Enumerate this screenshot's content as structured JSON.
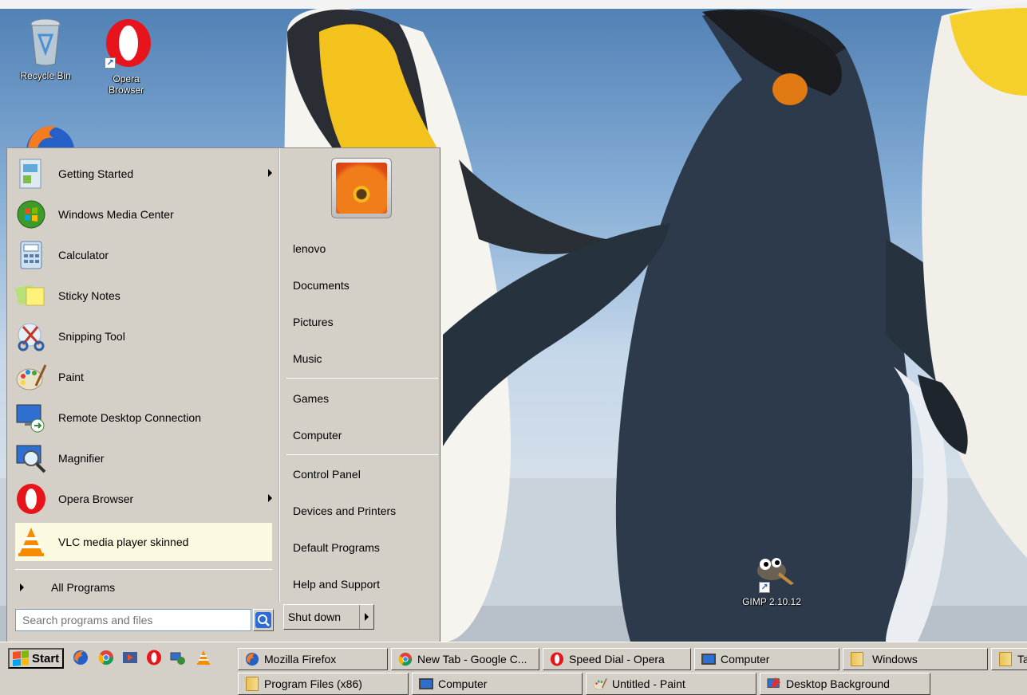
{
  "desktop": {
    "icons": [
      {
        "name": "recycle-bin",
        "label": "Recycle Bin"
      },
      {
        "name": "opera",
        "label": "Opera Browser"
      },
      {
        "name": "gimp",
        "label": "GIMP 2.10.12"
      }
    ]
  },
  "start_menu": {
    "programs": [
      {
        "label": "Getting Started",
        "icon": "getting-started-icon",
        "submenu": true
      },
      {
        "label": "Windows Media Center",
        "icon": "media-center-icon",
        "submenu": false
      },
      {
        "label": "Calculator",
        "icon": "calculator-icon",
        "submenu": false
      },
      {
        "label": "Sticky Notes",
        "icon": "sticky-notes-icon",
        "submenu": false
      },
      {
        "label": "Snipping Tool",
        "icon": "snipping-tool-icon",
        "submenu": false
      },
      {
        "label": "Paint",
        "icon": "paint-icon",
        "submenu": false
      },
      {
        "label": "Remote Desktop Connection",
        "icon": "remote-desktop-icon",
        "submenu": false
      },
      {
        "label": "Magnifier",
        "icon": "magnifier-icon",
        "submenu": false
      },
      {
        "label": "Opera Browser",
        "icon": "opera-icon",
        "submenu": true
      },
      {
        "label": "VLC media player skinned",
        "icon": "vlc-icon",
        "submenu": false,
        "highlighted": true
      }
    ],
    "all_programs": "All Programs",
    "search_placeholder": "Search programs and files",
    "right_items": {
      "user": "lenovo",
      "documents": "Documents",
      "pictures": "Pictures",
      "music": "Music",
      "games": "Games",
      "computer": "Computer",
      "control_panel": "Control Panel",
      "devices": "Devices and Printers",
      "default_programs": "Default Programs",
      "help": "Help and Support"
    },
    "shutdown": "Shut down"
  },
  "taskbar": {
    "start": "Start",
    "row1": [
      {
        "label": "Mozilla Firefox",
        "icon": "firefox-icon"
      },
      {
        "label": "New Tab - Google C...",
        "icon": "chrome-icon"
      },
      {
        "label": "Speed Dial - Opera",
        "icon": "opera-icon"
      },
      {
        "label": "Computer",
        "icon": "computer-icon"
      },
      {
        "label": "Windows",
        "icon": "folder-icon"
      },
      {
        "label": "Ta",
        "icon": "folder-icon"
      }
    ],
    "row2": [
      {
        "label": "Program Files (x86)",
        "icon": "folder-icon"
      },
      {
        "label": "Computer",
        "icon": "computer-icon"
      },
      {
        "label": "Untitled - Paint",
        "icon": "paint-icon"
      },
      {
        "label": "Desktop Background",
        "icon": "personalize-icon"
      }
    ]
  },
  "colors": {
    "menu_bg": "#d4d0c8",
    "highlight": "#fbfae1",
    "sky": "#86aed6"
  }
}
